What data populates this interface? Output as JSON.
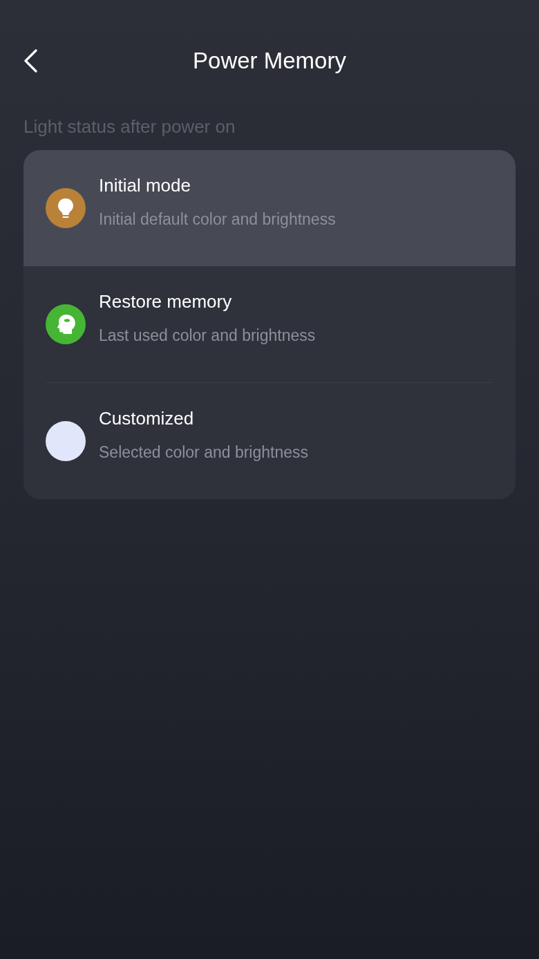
{
  "header": {
    "title": "Power Memory"
  },
  "section_label": "Light status after power on",
  "options": [
    {
      "kind": "bulb",
      "color": "#b98238",
      "title": "Initial mode",
      "description": "Initial default color and brightness",
      "selected": true
    },
    {
      "kind": "head",
      "color": "#46b535",
      "title": "Restore memory",
      "description": "Last used color and brightness",
      "selected": false
    },
    {
      "kind": "swatch",
      "color": "#e1e6fa",
      "title": "Customized",
      "description": "Selected color and brightness",
      "selected": false
    }
  ]
}
